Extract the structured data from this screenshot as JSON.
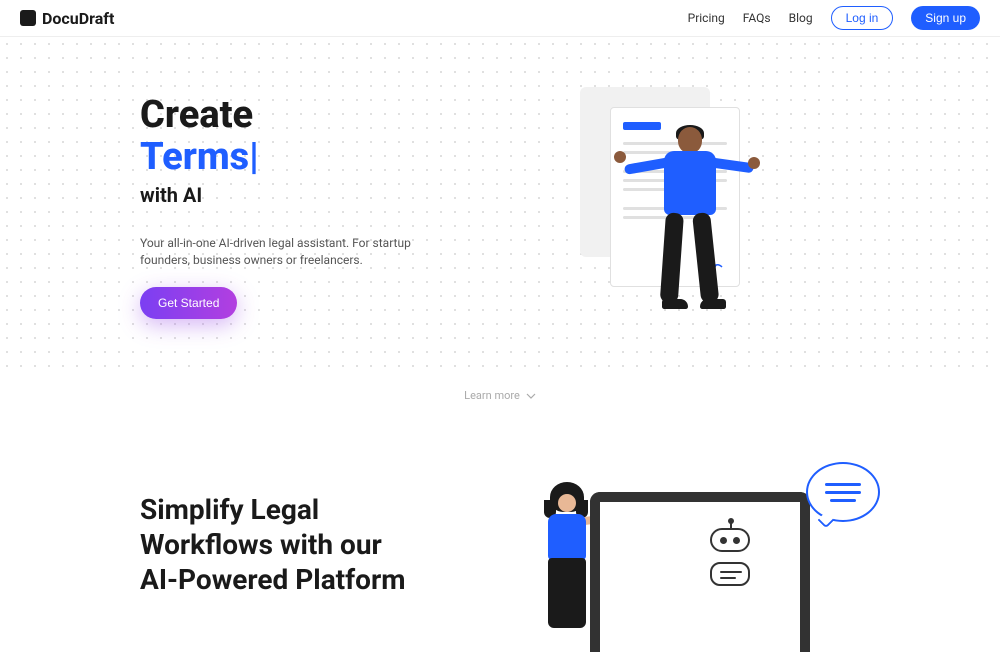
{
  "brand": "DocuDraft",
  "nav": {
    "pricing": "Pricing",
    "faqs": "FAQs",
    "blog": "Blog",
    "login": "Log in",
    "signup": "Sign up"
  },
  "hero": {
    "title_line1": "Create",
    "title_animated": "Terms|",
    "title_line3": "with AI",
    "subtitle": "Your all-in-one AI-driven legal assistant. For startup founders, business owners or freelancers.",
    "cta": "Get Started",
    "learn_more": "Learn more"
  },
  "section2": {
    "title": "Simplify Legal Workflows with our AI-Powered Platform"
  }
}
